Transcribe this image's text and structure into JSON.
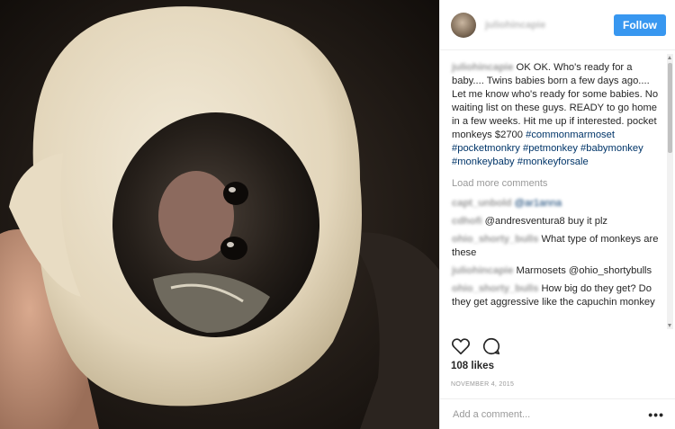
{
  "post": {
    "username": "juliohincapie",
    "follow_label": "Follow",
    "caption_user": "juliohincapie",
    "caption_text": "OK OK. Who's ready for a baby.... Twins babies born a few days ago.... Let me know who's ready for some babies. No waiting list on these guys. READY to go home in a few weeks. Hit me up if interested. pocket monkeys $2700",
    "hashtags": [
      "#commonmarmoset",
      "#pocketmonkry",
      "#petmonkey",
      "#babymonkey",
      "#monkeybaby",
      "#monkeyforsale"
    ],
    "load_more": "Load more comments",
    "comments": [
      {
        "user": "capt_unbold",
        "text": "@ar1anna",
        "text_blurred": true
      },
      {
        "user": "cdhofi",
        "text": "@andresventura8 buy it plz",
        "text_blurred": false
      },
      {
        "user": "ohio_shorty_bulls",
        "text": "What type of monkeys are these",
        "text_blurred": false
      },
      {
        "user": "juliohincapie",
        "text": "Marmosets @ohio_shortybulls",
        "text_blurred": false
      },
      {
        "user": "ohio_shorty_bulls",
        "text": "How big do they get? Do they get aggressive like the capuchin monkey",
        "text_blurred": false
      }
    ],
    "likes": "108 likes",
    "date": "NOVEMBER 4, 2015",
    "add_comment_placeholder": "Add a comment...",
    "more_options": "•••"
  },
  "icons": {
    "like": "heart-icon",
    "comment": "comment-icon"
  },
  "colors": {
    "follow_button": "#3897f0",
    "hashtag": "#003569"
  }
}
